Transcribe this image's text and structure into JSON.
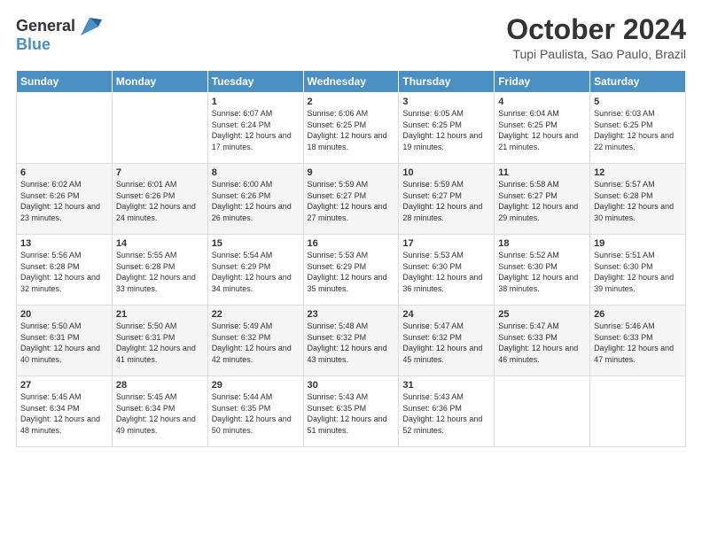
{
  "header": {
    "logo_line1": "General",
    "logo_line2": "Blue",
    "month_title": "October 2024",
    "location": "Tupi Paulista, Sao Paulo, Brazil"
  },
  "days_of_week": [
    "Sunday",
    "Monday",
    "Tuesday",
    "Wednesday",
    "Thursday",
    "Friday",
    "Saturday"
  ],
  "weeks": [
    [
      {
        "day": "",
        "sunrise": "",
        "sunset": "",
        "daylight": ""
      },
      {
        "day": "",
        "sunrise": "",
        "sunset": "",
        "daylight": ""
      },
      {
        "day": "1",
        "sunrise": "Sunrise: 6:07 AM",
        "sunset": "Sunset: 6:24 PM",
        "daylight": "Daylight: 12 hours and 17 minutes."
      },
      {
        "day": "2",
        "sunrise": "Sunrise: 6:06 AM",
        "sunset": "Sunset: 6:25 PM",
        "daylight": "Daylight: 12 hours and 18 minutes."
      },
      {
        "day": "3",
        "sunrise": "Sunrise: 6:05 AM",
        "sunset": "Sunset: 6:25 PM",
        "daylight": "Daylight: 12 hours and 19 minutes."
      },
      {
        "day": "4",
        "sunrise": "Sunrise: 6:04 AM",
        "sunset": "Sunset: 6:25 PM",
        "daylight": "Daylight: 12 hours and 21 minutes."
      },
      {
        "day": "5",
        "sunrise": "Sunrise: 6:03 AM",
        "sunset": "Sunset: 6:25 PM",
        "daylight": "Daylight: 12 hours and 22 minutes."
      }
    ],
    [
      {
        "day": "6",
        "sunrise": "Sunrise: 6:02 AM",
        "sunset": "Sunset: 6:26 PM",
        "daylight": "Daylight: 12 hours and 23 minutes."
      },
      {
        "day": "7",
        "sunrise": "Sunrise: 6:01 AM",
        "sunset": "Sunset: 6:26 PM",
        "daylight": "Daylight: 12 hours and 24 minutes."
      },
      {
        "day": "8",
        "sunrise": "Sunrise: 6:00 AM",
        "sunset": "Sunset: 6:26 PM",
        "daylight": "Daylight: 12 hours and 26 minutes."
      },
      {
        "day": "9",
        "sunrise": "Sunrise: 5:59 AM",
        "sunset": "Sunset: 6:27 PM",
        "daylight": "Daylight: 12 hours and 27 minutes."
      },
      {
        "day": "10",
        "sunrise": "Sunrise: 5:59 AM",
        "sunset": "Sunset: 6:27 PM",
        "daylight": "Daylight: 12 hours and 28 minutes."
      },
      {
        "day": "11",
        "sunrise": "Sunrise: 5:58 AM",
        "sunset": "Sunset: 6:27 PM",
        "daylight": "Daylight: 12 hours and 29 minutes."
      },
      {
        "day": "12",
        "sunrise": "Sunrise: 5:57 AM",
        "sunset": "Sunset: 6:28 PM",
        "daylight": "Daylight: 12 hours and 30 minutes."
      }
    ],
    [
      {
        "day": "13",
        "sunrise": "Sunrise: 5:56 AM",
        "sunset": "Sunset: 6:28 PM",
        "daylight": "Daylight: 12 hours and 32 minutes."
      },
      {
        "day": "14",
        "sunrise": "Sunrise: 5:55 AM",
        "sunset": "Sunset: 6:28 PM",
        "daylight": "Daylight: 12 hours and 33 minutes."
      },
      {
        "day": "15",
        "sunrise": "Sunrise: 5:54 AM",
        "sunset": "Sunset: 6:29 PM",
        "daylight": "Daylight: 12 hours and 34 minutes."
      },
      {
        "day": "16",
        "sunrise": "Sunrise: 5:53 AM",
        "sunset": "Sunset: 6:29 PM",
        "daylight": "Daylight: 12 hours and 35 minutes."
      },
      {
        "day": "17",
        "sunrise": "Sunrise: 5:53 AM",
        "sunset": "Sunset: 6:30 PM",
        "daylight": "Daylight: 12 hours and 36 minutes."
      },
      {
        "day": "18",
        "sunrise": "Sunrise: 5:52 AM",
        "sunset": "Sunset: 6:30 PM",
        "daylight": "Daylight: 12 hours and 38 minutes."
      },
      {
        "day": "19",
        "sunrise": "Sunrise: 5:51 AM",
        "sunset": "Sunset: 6:30 PM",
        "daylight": "Daylight: 12 hours and 39 minutes."
      }
    ],
    [
      {
        "day": "20",
        "sunrise": "Sunrise: 5:50 AM",
        "sunset": "Sunset: 6:31 PM",
        "daylight": "Daylight: 12 hours and 40 minutes."
      },
      {
        "day": "21",
        "sunrise": "Sunrise: 5:50 AM",
        "sunset": "Sunset: 6:31 PM",
        "daylight": "Daylight: 12 hours and 41 minutes."
      },
      {
        "day": "22",
        "sunrise": "Sunrise: 5:49 AM",
        "sunset": "Sunset: 6:32 PM",
        "daylight": "Daylight: 12 hours and 42 minutes."
      },
      {
        "day": "23",
        "sunrise": "Sunrise: 5:48 AM",
        "sunset": "Sunset: 6:32 PM",
        "daylight": "Daylight: 12 hours and 43 minutes."
      },
      {
        "day": "24",
        "sunrise": "Sunrise: 5:47 AM",
        "sunset": "Sunset: 6:32 PM",
        "daylight": "Daylight: 12 hours and 45 minutes."
      },
      {
        "day": "25",
        "sunrise": "Sunrise: 5:47 AM",
        "sunset": "Sunset: 6:33 PM",
        "daylight": "Daylight: 12 hours and 46 minutes."
      },
      {
        "day": "26",
        "sunrise": "Sunrise: 5:46 AM",
        "sunset": "Sunset: 6:33 PM",
        "daylight": "Daylight: 12 hours and 47 minutes."
      }
    ],
    [
      {
        "day": "27",
        "sunrise": "Sunrise: 5:45 AM",
        "sunset": "Sunset: 6:34 PM",
        "daylight": "Daylight: 12 hours and 48 minutes."
      },
      {
        "day": "28",
        "sunrise": "Sunrise: 5:45 AM",
        "sunset": "Sunset: 6:34 PM",
        "daylight": "Daylight: 12 hours and 49 minutes."
      },
      {
        "day": "29",
        "sunrise": "Sunrise: 5:44 AM",
        "sunset": "Sunset: 6:35 PM",
        "daylight": "Daylight: 12 hours and 50 minutes."
      },
      {
        "day": "30",
        "sunrise": "Sunrise: 5:43 AM",
        "sunset": "Sunset: 6:35 PM",
        "daylight": "Daylight: 12 hours and 51 minutes."
      },
      {
        "day": "31",
        "sunrise": "Sunrise: 5:43 AM",
        "sunset": "Sunset: 6:36 PM",
        "daylight": "Daylight: 12 hours and 52 minutes."
      },
      {
        "day": "",
        "sunrise": "",
        "sunset": "",
        "daylight": ""
      },
      {
        "day": "",
        "sunrise": "",
        "sunset": "",
        "daylight": ""
      }
    ]
  ]
}
